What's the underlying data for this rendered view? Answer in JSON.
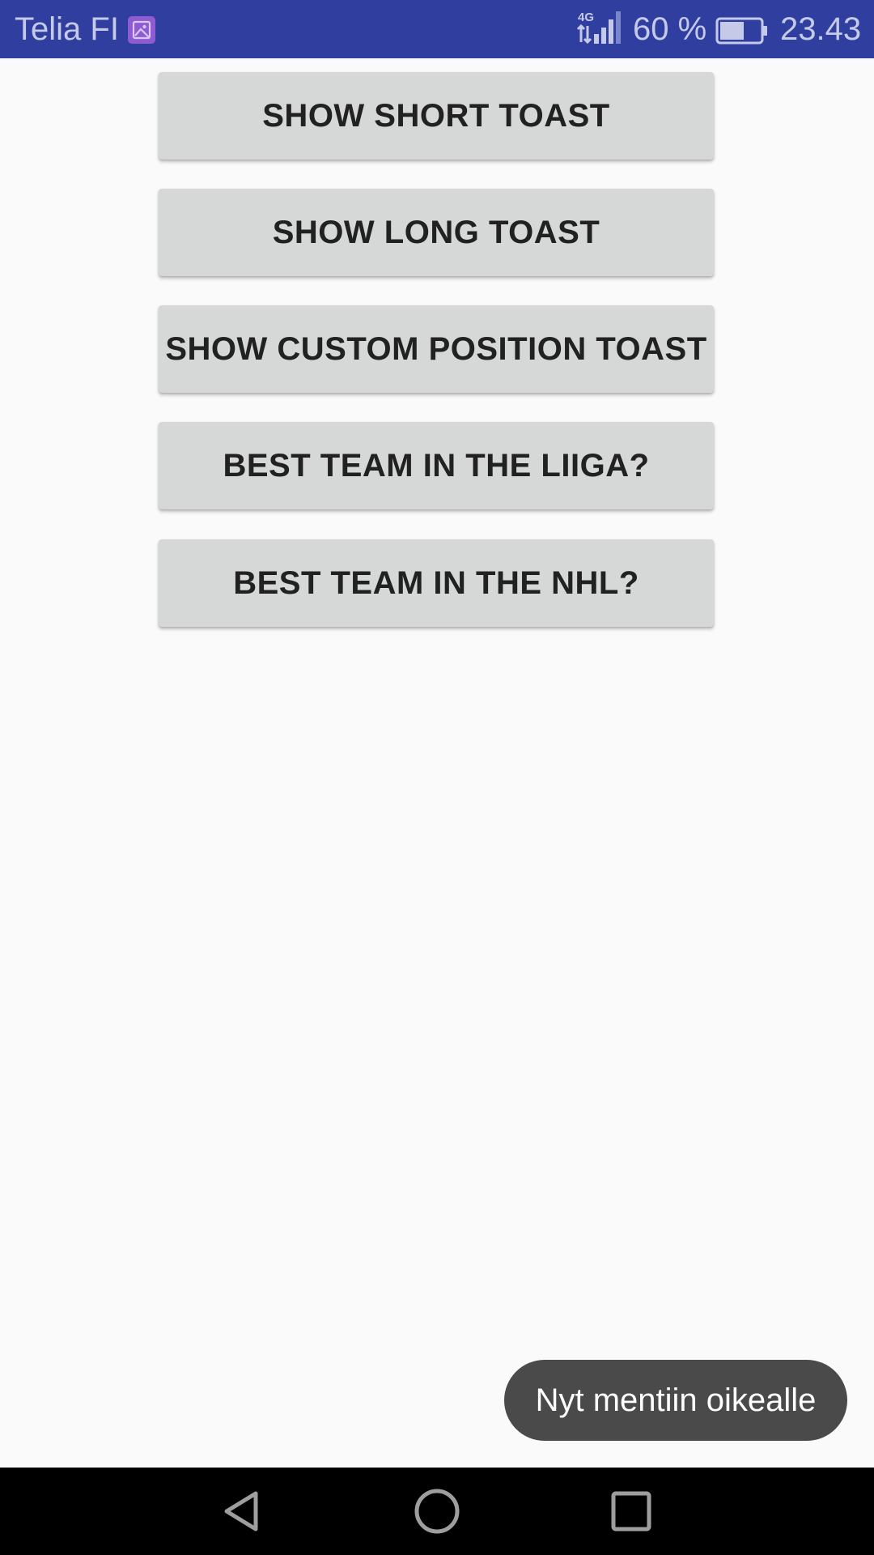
{
  "status_bar": {
    "carrier": "Telia FI",
    "network_label": "4G",
    "battery_percent": "60 %",
    "battery_level": 0.6,
    "time": "23.43",
    "background_color": "#303f9f",
    "icons": [
      "image-notification-icon",
      "4g-signal-icon",
      "battery-icon"
    ]
  },
  "buttons": {
    "show_short_toast": "SHOW SHORT TOAST",
    "show_long_toast": "SHOW LONG TOAST",
    "show_custom_position_toast": "SHOW CUSTOM POSITION TOAST",
    "best_team_liiga": "BEST TEAM IN THE LIIGA?",
    "best_team_nhl": "BEST TEAM IN THE NHL?"
  },
  "toast": {
    "message": "Nyt mentiin oikealle"
  },
  "nav_bar": {
    "icons": [
      "back-icon",
      "home-icon",
      "recents-icon"
    ]
  }
}
